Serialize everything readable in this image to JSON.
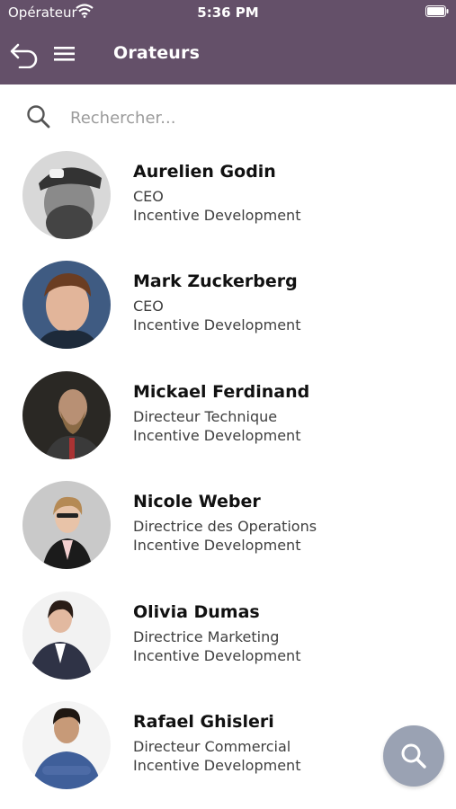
{
  "status_bar": {
    "carrier": "Opérateur",
    "time": "5:36 PM"
  },
  "app_bar": {
    "title": "Orateurs",
    "back_icon": "back-arrow-icon",
    "menu_icon": "hamburger-menu-icon"
  },
  "search": {
    "placeholder": "Rechercher...",
    "value": "",
    "icon": "search-icon"
  },
  "speakers": [
    {
      "name": "Aurelien Godin",
      "role": "CEO",
      "company": "Incentive Development",
      "avatar_bg": "#d8d8d8"
    },
    {
      "name": "Mark Zuckerberg",
      "role": "CEO",
      "company": "Incentive Development",
      "avatar_bg": "#3f5b82"
    },
    {
      "name": "Mickael Ferdinand",
      "role": "Directeur Technique",
      "company": "Incentive Development",
      "avatar_bg": "#2a2824"
    },
    {
      "name": "Nicole Weber",
      "role": "Directrice des Operations",
      "company": "Incentive Development",
      "avatar_bg": "#c9c9c9"
    },
    {
      "name": "Olivia Dumas",
      "role": "Directrice Marketing",
      "company": "Incentive Development",
      "avatar_bg": "#f2f2f2"
    },
    {
      "name": "Rafael Ghisleri",
      "role": "Directeur Commercial",
      "company": "Incentive Development",
      "avatar_bg": "#f4f4f4"
    }
  ],
  "fab": {
    "icon": "search-icon",
    "color": "#9aa2b3"
  },
  "colors": {
    "primary": "#645069",
    "text": "#111111",
    "subtext": "#3f3f3f"
  }
}
